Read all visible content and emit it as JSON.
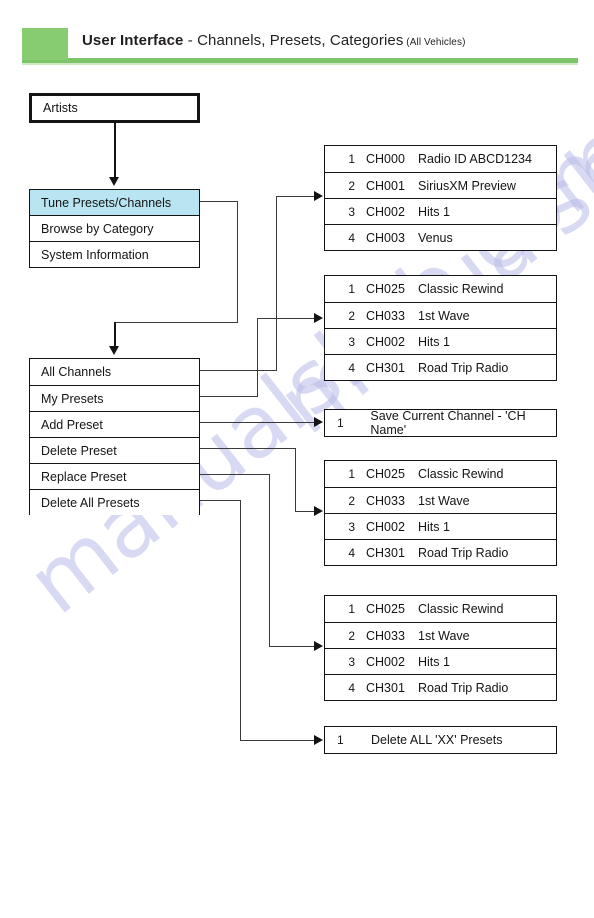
{
  "header": {
    "title_bold": "User Interface",
    "title_rest": " - Channels, Presets, Categories",
    "title_sub": " (All Vehicles)",
    "accent_color": "#88cc72"
  },
  "watermark": {
    "line1": "manualshlib.com",
    "line2": "manualshlib.com"
  },
  "diagram": {
    "entry_box": {
      "label": "Artists"
    },
    "menu_main": {
      "items": [
        {
          "label": "Tune Presets/Channels",
          "highlight": true
        },
        {
          "label": "Browse by Category",
          "highlight": false
        },
        {
          "label": "System Information",
          "highlight": false
        }
      ],
      "highlight_color": "#b9e5f2"
    },
    "menu_presets": {
      "items": [
        {
          "label": "All Channels"
        },
        {
          "label": "My Presets"
        },
        {
          "label": "Add Preset"
        },
        {
          "label": "Delete Preset"
        },
        {
          "label": "Replace Preset"
        },
        {
          "label": "Delete All Presets"
        }
      ]
    },
    "panels": [
      {
        "name": "all-channels-list",
        "rows": [
          {
            "num": "1",
            "channel": "CH000",
            "name": "Radio ID  ABCD1234"
          },
          {
            "num": "2",
            "channel": "CH001",
            "name": "SiriusXM Preview"
          },
          {
            "num": "3",
            "channel": "CH002",
            "name": "Hits 1"
          },
          {
            "num": "4",
            "channel": "CH003",
            "name": "Venus"
          }
        ]
      },
      {
        "name": "my-presets-list",
        "rows": [
          {
            "num": "1",
            "channel": "CH025",
            "name": "Classic Rewind"
          },
          {
            "num": "2",
            "channel": "CH033",
            "name": "1st Wave"
          },
          {
            "num": "3",
            "channel": "CH002",
            "name": "Hits 1"
          },
          {
            "num": "4",
            "channel": "CH301",
            "name": "Road Trip Radio"
          }
        ]
      },
      {
        "name": "add-preset-action",
        "rows": [
          {
            "num": "1",
            "text": "Save Current Channel - 'CH Name'"
          }
        ]
      },
      {
        "name": "delete-preset-list",
        "rows": [
          {
            "num": "1",
            "channel": "CH025",
            "name": "Classic Rewind"
          },
          {
            "num": "2",
            "channel": "CH033",
            "name": "1st Wave"
          },
          {
            "num": "3",
            "channel": "CH002",
            "name": "Hits 1"
          },
          {
            "num": "4",
            "channel": "CH301",
            "name": "Road Trip Radio"
          }
        ]
      },
      {
        "name": "replace-preset-list",
        "rows": [
          {
            "num": "1",
            "channel": "CH025",
            "name": "Classic Rewind"
          },
          {
            "num": "2",
            "channel": "CH033",
            "name": "1st Wave"
          },
          {
            "num": "3",
            "channel": "CH002",
            "name": "Hits 1"
          },
          {
            "num": "4",
            "channel": "CH301",
            "name": "Road Trip Radio"
          }
        ]
      },
      {
        "name": "delete-all-presets-action",
        "rows": [
          {
            "num": "1",
            "text": "Delete ALL 'XX' Presets"
          }
        ]
      }
    ]
  }
}
